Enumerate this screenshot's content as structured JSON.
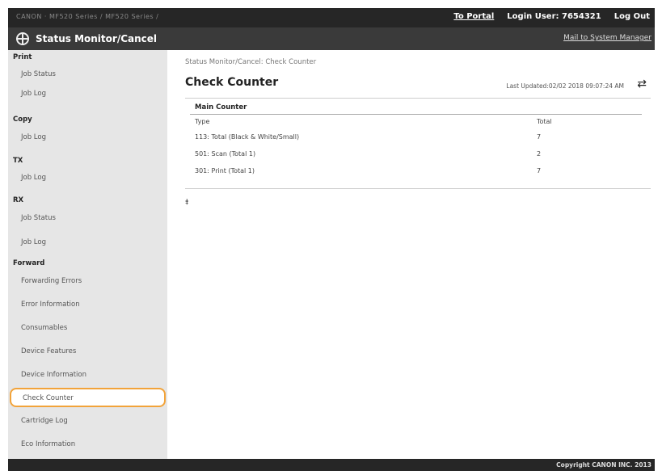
{
  "topbar": {
    "device": "CANON  ·  MF520 Series / MF520 Series /",
    "to_portal": "To Portal",
    "login_user": "Login User:  7654321",
    "logout": "Log Out"
  },
  "header": {
    "title": "Status Monitor/Cancel",
    "mail": "Mail to System Manager"
  },
  "sidebar": {
    "sections": [
      {
        "label": "Print",
        "items": [
          "Job Status",
          "Job Log"
        ]
      },
      {
        "label": "Copy",
        "items": [
          "Job Log"
        ]
      },
      {
        "label": "TX",
        "items": [
          "Job Log"
        ]
      },
      {
        "label": "RX",
        "items": [
          "Job Status",
          "Job Log"
        ]
      },
      {
        "label": "Forward",
        "items": [
          "Forwarding Errors",
          "Error Information",
          "Consumables",
          "Device Features",
          "Device Information",
          "Check Counter",
          "Cartridge Log",
          "Eco Information"
        ]
      }
    ],
    "selected": "Check Counter"
  },
  "main": {
    "breadcrumb": "Status Monitor/Cancel: Check Counter",
    "title": "Check Counter",
    "last_updated": "Last Updated:02/02 2018 09:07:24 AM",
    "section_title": "Main Counter",
    "columns": [
      "Type",
      "Total"
    ],
    "rows": [
      {
        "type": "113: Total (Black & White/Small)",
        "total": "7"
      },
      {
        "type": "501: Scan (Total 1)",
        "total": "2"
      },
      {
        "type": "301: Print (Total 1)",
        "total": "7"
      }
    ],
    "to_top": "⯒"
  },
  "footer": {
    "copyright": "Copyright CANON INC. 2013"
  }
}
